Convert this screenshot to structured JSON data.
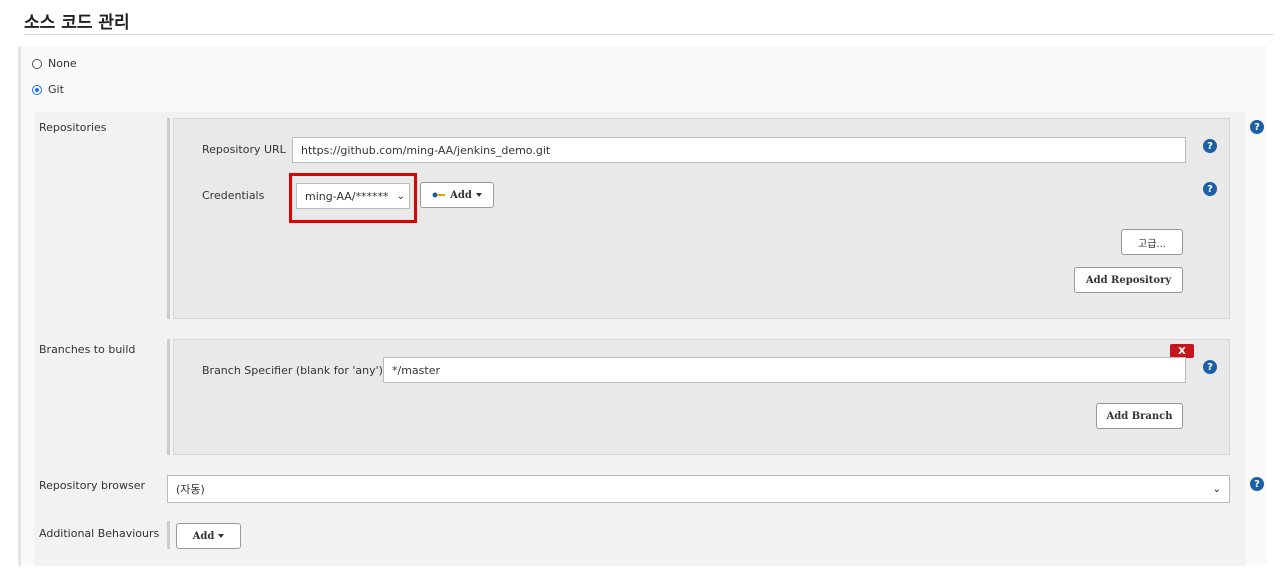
{
  "section": {
    "title": "소스 코드 관리"
  },
  "scm_options": [
    {
      "label": "None",
      "selected": false
    },
    {
      "label": "Git",
      "selected": true
    }
  ],
  "repositories": {
    "label": "Repositories",
    "url_label": "Repository URL",
    "url_value": "https://github.com/ming-AA/jenkins_demo.git",
    "credentials_label": "Credentials",
    "credentials_value": "ming-AA/******",
    "add_label": "Add",
    "advanced_label": "고급...",
    "add_repository_label": "Add Repository"
  },
  "branches": {
    "label": "Branches to build",
    "specifier_label": "Branch Specifier (blank for 'any')",
    "specifier_value": "*/master",
    "delete_label": "X",
    "add_branch_label": "Add Branch"
  },
  "repository_browser": {
    "label": "Repository browser",
    "value": "(자동)"
  },
  "additional_behaviours": {
    "label": "Additional Behaviours",
    "add_label": "Add"
  },
  "colors": {
    "help": "#1b5fa8",
    "highlight": "#e20000",
    "delete": "#c4161c"
  },
  "icons": {
    "help": "question-icon",
    "credentials": "key-icon"
  }
}
